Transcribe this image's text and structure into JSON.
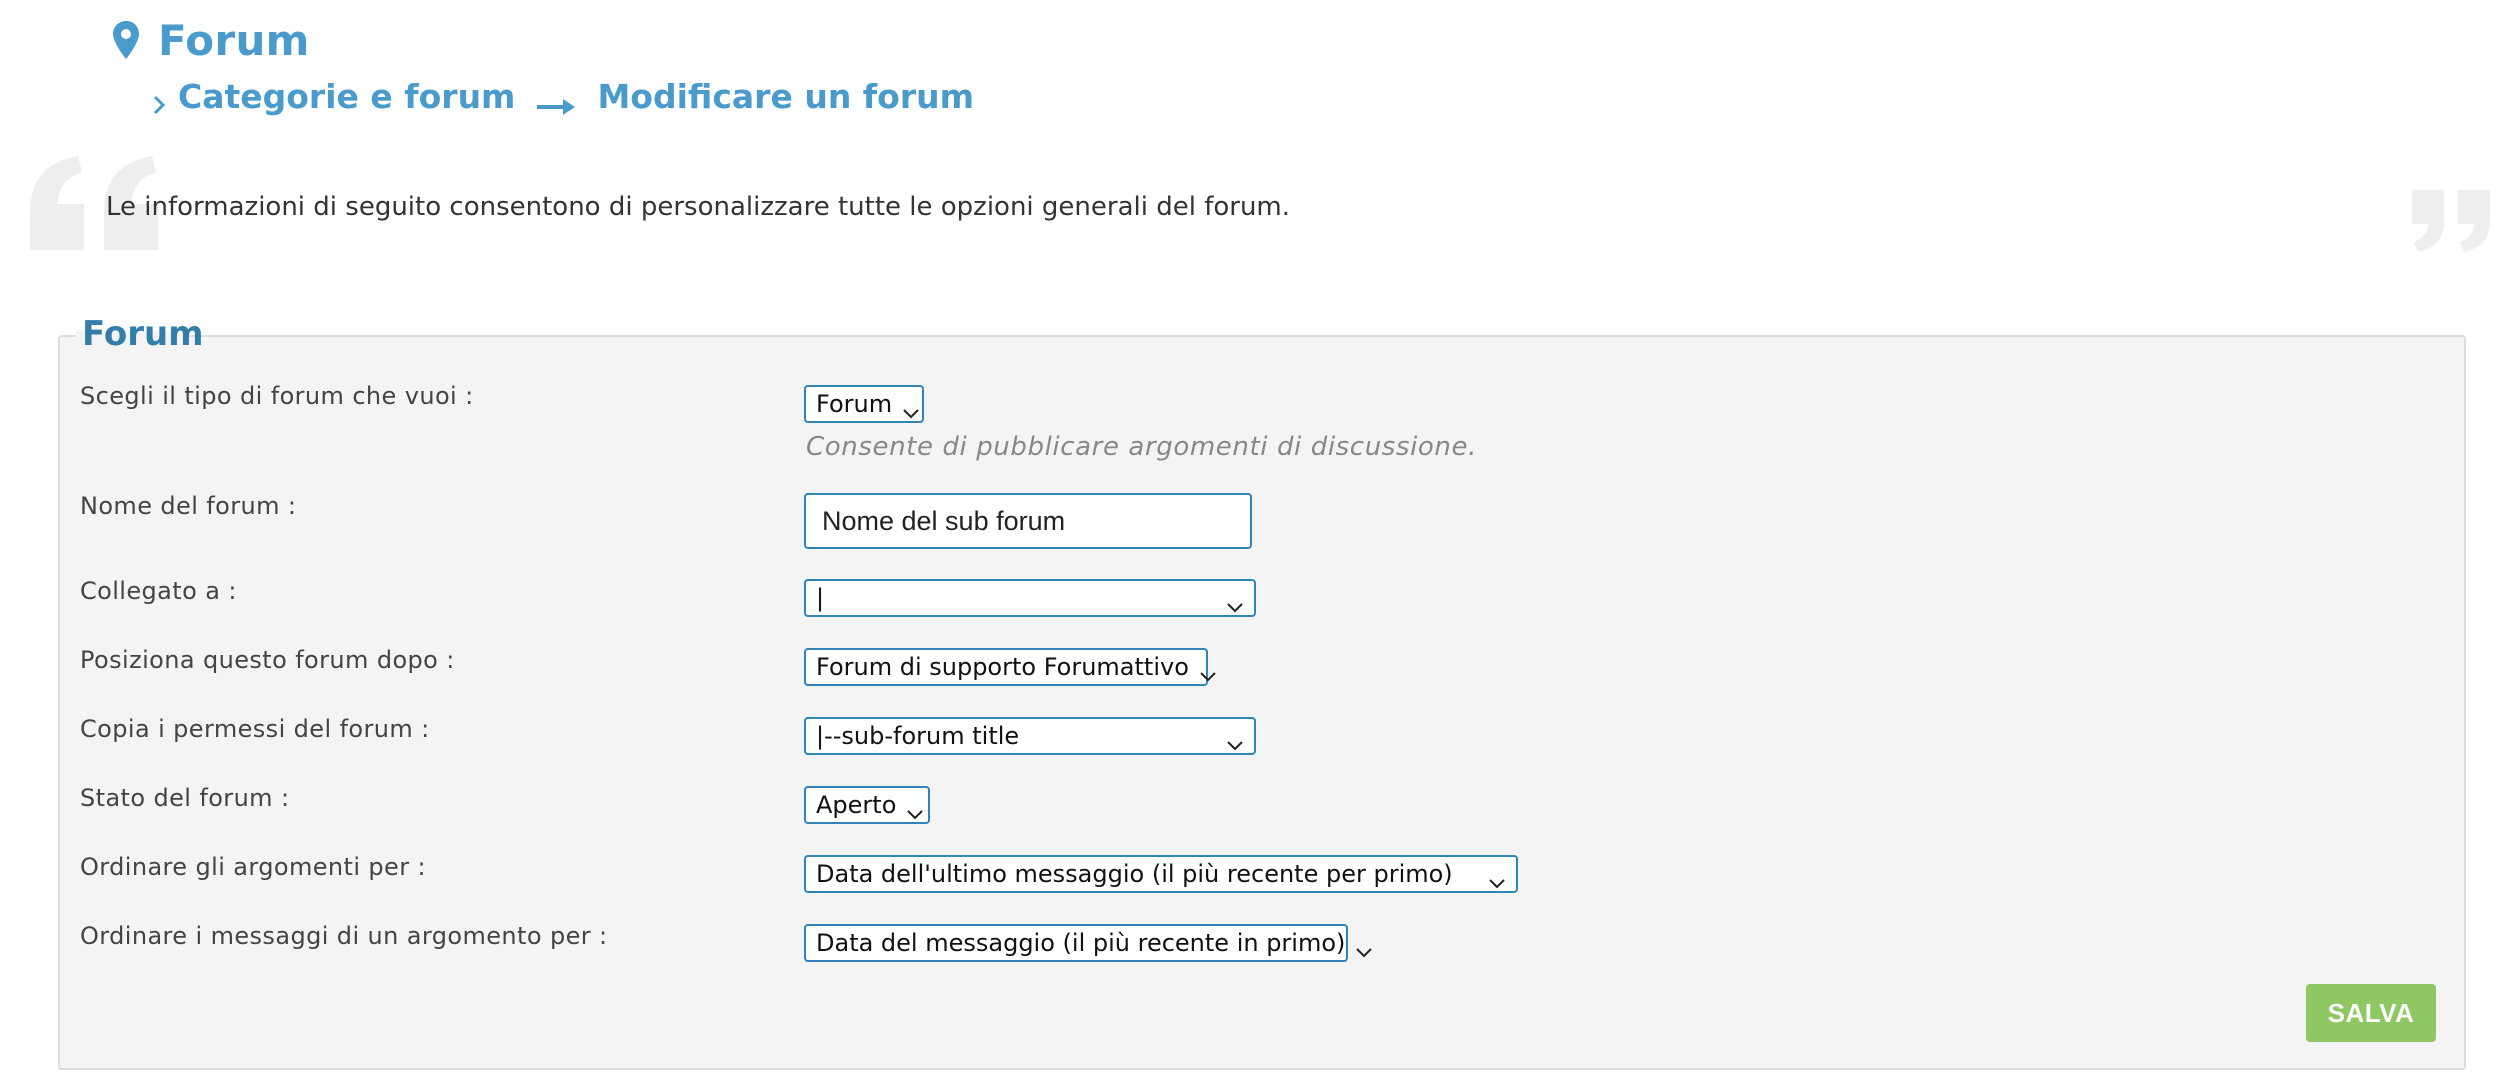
{
  "header": {
    "title": "Forum",
    "breadcrumb": {
      "section": "Categorie e forum",
      "page": "Modificare un forum"
    }
  },
  "intro": "Le informazioni di seguito consentono di personalizzare tutte le opzioni generali del forum.",
  "form": {
    "legend": "Forum",
    "type": {
      "label": "Scegli il tipo di forum che vuoi :",
      "value": "Forum",
      "hint": "Consente di pubblicare argomenti di discussione."
    },
    "name": {
      "label": "Nome del forum :",
      "value": "Nome del sub forum"
    },
    "linked_to": {
      "label": "Collegato a :",
      "value": "|"
    },
    "position_after": {
      "label": "Posiziona questo forum dopo :",
      "value": "Forum di supporto Forumattivo"
    },
    "copy_permissions": {
      "label": "Copia i permessi del forum :",
      "value": "|--sub-forum title"
    },
    "status": {
      "label": "Stato del forum :",
      "value": "Aperto"
    },
    "topic_order": {
      "label": "Ordinare gli argomenti per :",
      "value": "Data dell'ultimo messaggio (il più recente per primo)"
    },
    "message_order": {
      "label": "Ordinare i messaggi di un argomento per :",
      "value": "Data del messaggio (il più recente in primo)"
    },
    "save_label": "SALVA"
  },
  "colors": {
    "accent": "#4a9bcb",
    "legend": "#327ea8",
    "input_border": "#2f84b8",
    "save_button": "#8fc862",
    "panel_bg": "#f4f4f4"
  },
  "icons": {
    "title": "map-pin-icon",
    "breadcrumb_prefix": "chevron-right-icon",
    "breadcrumb_separator": "arrow-right-icon",
    "quotes": [
      "open-quote-icon",
      "close-quote-icon"
    ],
    "select": "chevron-down-icon"
  }
}
